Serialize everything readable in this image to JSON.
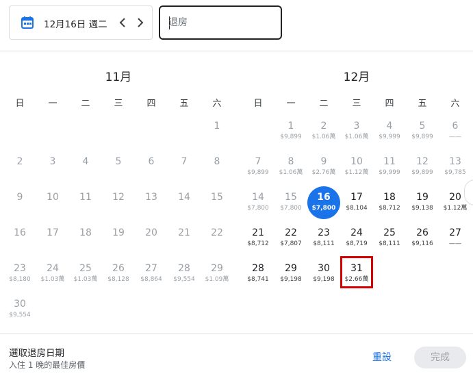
{
  "header": {
    "date_text": "12月16日 週二",
    "checkout_placeholder": "退房",
    "checkout_value": ""
  },
  "months": [
    {
      "title": "11月",
      "weekdays": [
        "日",
        "一",
        "二",
        "三",
        "四",
        "五",
        "六"
      ],
      "days": [
        {
          "d": "1",
          "p": "",
          "past": true
        },
        {
          "d": "2",
          "p": "",
          "past": true
        },
        {
          "d": "3",
          "p": "",
          "past": true
        },
        {
          "d": "4",
          "p": "",
          "past": true
        },
        {
          "d": "5",
          "p": "",
          "past": true
        },
        {
          "d": "6",
          "p": "",
          "past": true
        },
        {
          "d": "7",
          "p": "",
          "past": true
        },
        {
          "d": "8",
          "p": "",
          "past": true
        },
        {
          "d": "9",
          "p": "",
          "past": true
        },
        {
          "d": "10",
          "p": "",
          "past": true
        },
        {
          "d": "11",
          "p": "",
          "past": true
        },
        {
          "d": "12",
          "p": "",
          "past": true
        },
        {
          "d": "13",
          "p": "",
          "past": true
        },
        {
          "d": "14",
          "p": "",
          "past": true
        },
        {
          "d": "15",
          "p": "",
          "past": true
        },
        {
          "d": "16",
          "p": "",
          "past": true
        },
        {
          "d": "17",
          "p": "",
          "past": true
        },
        {
          "d": "18",
          "p": "",
          "past": true
        },
        {
          "d": "19",
          "p": "",
          "past": true
        },
        {
          "d": "20",
          "p": "",
          "past": true
        },
        {
          "d": "21",
          "p": "",
          "past": true
        },
        {
          "d": "22",
          "p": "",
          "past": true
        },
        {
          "d": "23",
          "p": "$8,180",
          "past": true
        },
        {
          "d": "24",
          "p": "$1.03萬",
          "past": true
        },
        {
          "d": "25",
          "p": "$1.03萬",
          "past": true
        },
        {
          "d": "26",
          "p": "$8,128",
          "past": true
        },
        {
          "d": "27",
          "p": "$8,864",
          "past": true
        },
        {
          "d": "28",
          "p": "$9,554",
          "past": true
        },
        {
          "d": "29",
          "p": "$1.09萬",
          "past": true
        },
        {
          "d": "30",
          "p": "$9,554",
          "past": true
        }
      ]
    },
    {
      "title": "12月",
      "weekdays": [
        "日",
        "一",
        "二",
        "三",
        "四",
        "五",
        "六"
      ],
      "days": [
        {
          "d": "1",
          "p": "$9,899",
          "past": true
        },
        {
          "d": "2",
          "p": "$1.06萬",
          "past": true
        },
        {
          "d": "3",
          "p": "$1.06萬",
          "past": true
        },
        {
          "d": "4",
          "p": "$9,999",
          "past": true
        },
        {
          "d": "5",
          "p": "$9,899",
          "past": true
        },
        {
          "d": "6",
          "p": "——",
          "past": true
        },
        {
          "d": "7",
          "p": "$9,899",
          "past": true
        },
        {
          "d": "8",
          "p": "$1.06萬",
          "past": true
        },
        {
          "d": "9",
          "p": "$2.76萬",
          "past": true
        },
        {
          "d": "10",
          "p": "$1.12萬",
          "past": true
        },
        {
          "d": "11",
          "p": "$9,999",
          "past": true
        },
        {
          "d": "12",
          "p": "$9,899",
          "past": true
        },
        {
          "d": "13",
          "p": "$9,785",
          "past": true
        },
        {
          "d": "14",
          "p": "$7,800",
          "past": true
        },
        {
          "d": "15",
          "p": "$7,800",
          "past": true
        },
        {
          "d": "16",
          "p": "$7,800",
          "past": false,
          "selected": true
        },
        {
          "d": "17",
          "p": "$8,104",
          "past": false
        },
        {
          "d": "18",
          "p": "$8,712",
          "past": false
        },
        {
          "d": "19",
          "p": "$9,138",
          "past": false
        },
        {
          "d": "20",
          "p": "$1.12萬",
          "past": false
        },
        {
          "d": "21",
          "p": "$8,712",
          "past": false
        },
        {
          "d": "22",
          "p": "$7,807",
          "past": false
        },
        {
          "d": "23",
          "p": "$8,111",
          "past": false
        },
        {
          "d": "24",
          "p": "$8,719",
          "past": false
        },
        {
          "d": "25",
          "p": "$8,111",
          "past": false
        },
        {
          "d": "26",
          "p": "$9,116",
          "past": false
        },
        {
          "d": "27",
          "p": "——",
          "past": false
        },
        {
          "d": "28",
          "p": "$8,741",
          "past": false
        },
        {
          "d": "29",
          "p": "$9,198",
          "past": false
        },
        {
          "d": "30",
          "p": "$9,198",
          "past": false
        },
        {
          "d": "31",
          "p": "$2.66萬",
          "past": false,
          "highlighted": true
        }
      ]
    }
  ],
  "footer": {
    "title": "選取退房日期",
    "subtitle": "入住 1 晚的最佳房價",
    "reset_label": "重設",
    "done_label": "完成"
  },
  "colors": {
    "accent": "#1a73e8",
    "highlight": "#d50000"
  }
}
